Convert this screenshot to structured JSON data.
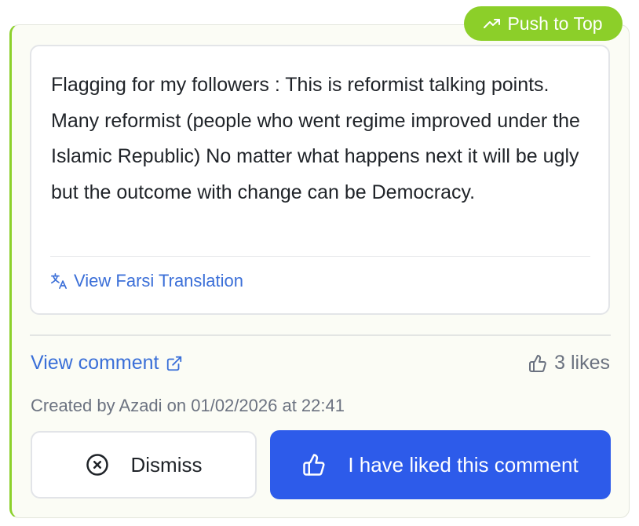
{
  "badge": {
    "label": "Push to Top",
    "icon": "trending-up-icon"
  },
  "comment": {
    "text": "Flagging for my followers : This is reformist talking points. Many reformist (people who went regime improved under the Islamic Republic) No matter what happens next it will be ugly but the outcome with change can be Democracy.",
    "translation_link": "View Farsi Translation",
    "translation_icon": "translate-icon"
  },
  "footer": {
    "view_comment_label": "View comment",
    "view_comment_icon": "external-link-icon",
    "likes_label": "3 likes",
    "likes_icon": "thumbs-up-icon",
    "created_text": "Created by Azadi on 01/02/2026 at 22:41"
  },
  "actions": {
    "dismiss_label": "Dismiss",
    "dismiss_icon": "x-circle-icon",
    "liked_label": "I have liked this comment",
    "liked_icon": "thumbs-up-icon"
  },
  "colors": {
    "accent_green": "#8ccf29",
    "link_blue": "#3a6fd8",
    "primary_blue": "#2d5bea",
    "muted_text": "#6b7280",
    "card_background": "#fbfcf5"
  }
}
